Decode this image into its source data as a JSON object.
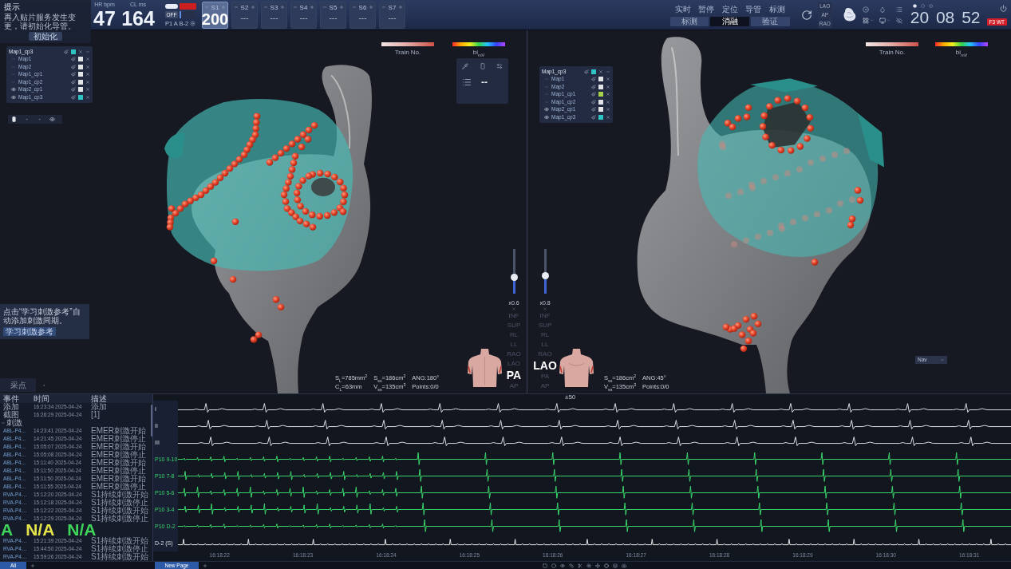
{
  "header": {
    "notice": {
      "title": "提示",
      "message": "再入贴片服务发生变更，请初始化导管。",
      "button": "初始化"
    },
    "vitals": [
      {
        "label": "HR bpm",
        "value": "47"
      },
      {
        "label": "CL ms",
        "value": "164"
      }
    ],
    "stimulator": {
      "switch_on": true,
      "output": "OFF",
      "channel": "P1 A B-2"
    },
    "stim_steps": [
      {
        "label": "S1",
        "value": "200",
        "selected": true
      },
      {
        "label": "S2",
        "value": "---",
        "selected": false
      },
      {
        "label": "S3",
        "value": "---",
        "selected": false
      },
      {
        "label": "S4",
        "value": "---",
        "selected": false
      },
      {
        "label": "S5",
        "value": "---",
        "selected": false
      },
      {
        "label": "S6",
        "value": "---",
        "selected": false
      },
      {
        "label": "S7",
        "value": "---",
        "selected": false
      }
    ],
    "mode_buttons": [
      "实时",
      "暂停",
      "定位",
      "导管",
      "标测"
    ],
    "workflow_tabs": [
      {
        "label": "标测",
        "selected": false
      },
      {
        "label": "消融",
        "selected": true
      },
      {
        "label": "验证",
        "selected": false
      }
    ],
    "view_presets": [
      "LAO",
      "AP",
      "RAO"
    ],
    "clock": "20 08 52",
    "alert_badge": "F3 WT"
  },
  "views": [
    {
      "map_list": {
        "title": "Map1_cp3",
        "color": "#2ec4c4",
        "items": [
          {
            "name": "Map1",
            "visible": false,
            "color": "#e2e4e8"
          },
          {
            "name": "Map2",
            "visible": false,
            "color": "#e2e4e8"
          },
          {
            "name": "Map1_cp1",
            "visible": false,
            "color": "#e2e4e8"
          },
          {
            "name": "Map1_cp2",
            "visible": false,
            "color": "#e2e4e8"
          },
          {
            "name": "Map2_cp1",
            "visible": true,
            "color": "#e2e4e8"
          },
          {
            "name": "Map1_cp3",
            "visible": true,
            "color": "#2ec4c4"
          }
        ]
      },
      "legends": [
        {
          "kind": "train",
          "label": "Train No."
        },
        {
          "kind": "voltage",
          "label": "bi$_{mV}$"
        }
      ],
      "value_panel": {
        "value": "--"
      },
      "zoom": {
        "label": "x0.6",
        "level": 0.35
      },
      "orientations": [
        {
          "label": "INF",
          "selected": false
        },
        {
          "label": "SUP",
          "selected": false
        },
        {
          "label": "RL",
          "selected": false
        },
        {
          "label": "LL",
          "selected": false
        },
        {
          "label": "RAO",
          "selected": false
        },
        {
          "label": "LAO",
          "selected": false
        },
        {
          "label": "PA",
          "selected": true
        },
        {
          "label": "AP",
          "selected": false
        }
      ],
      "stats": [
        "S$_{L}$=785mm$^{2}$",
        "S$_{ss}$=186cm$^{2}$",
        "ANG:180°",
        "C$_{L}$=63mm",
        "V$_{ss}$=135cm$^{3}$",
        "Points:0/0"
      ]
    },
    {
      "map_list": {
        "title": "Map1_cp3",
        "color": "#2ec4c4",
        "items": [
          {
            "name": "Map1",
            "visible": false,
            "color": "#e2e4e8"
          },
          {
            "name": "Map2",
            "visible": false,
            "color": "#e2e4e8"
          },
          {
            "name": "Map1_cp1",
            "visible": false,
            "color": "#a8d24a"
          },
          {
            "name": "Map1_cp2",
            "visible": false,
            "color": "#e2e4e8"
          },
          {
            "name": "Map2_cp1",
            "visible": true,
            "color": "#e2e4e8"
          },
          {
            "name": "Map1_cp3",
            "visible": true,
            "color": "#2ec4c4"
          }
        ]
      },
      "legends": [
        {
          "kind": "train",
          "label": "Train No."
        },
        {
          "kind": "voltage",
          "label": "bi$_{mV}$"
        }
      ],
      "zoom": {
        "label": "x0.8",
        "level": 0.38
      },
      "orientations": [
        {
          "label": "INF",
          "selected": false
        },
        {
          "label": "SUP",
          "selected": false
        },
        {
          "label": "RL",
          "selected": false
        },
        {
          "label": "LL",
          "selected": false
        },
        {
          "label": "RAO",
          "selected": false
        },
        {
          "label": "LAO",
          "selected": true
        },
        {
          "label": "PA",
          "selected": false
        },
        {
          "label": "AP",
          "selected": false
        }
      ],
      "stats": [
        "S$_{ss}$=186cm$^{2}$",
        "ANG:45°",
        "V$_{ss}$=135cm$^{3}$",
        "Points:0/0"
      ],
      "nav_menu": "Nav"
    }
  ],
  "hint": {
    "message": "点击“学习刺激参考”自动添加刺激间期。",
    "button": "学习刺激参考"
  },
  "capture_tab": "采点",
  "events": {
    "columns": [
      "事件",
      "时间",
      "描述"
    ],
    "rows": [
      {
        "event": "添加",
        "time": "16:23:34 2025-04-24",
        "description": "添加"
      },
      {
        "event": "截图",
        "time": "16:26:29 2025-04-24",
        "description": "[1]"
      },
      {
        "event": "刺激",
        "expanded": true,
        "children": [
          {
            "event": "ABL-P4…",
            "time": "14:23:41 2025-04-24",
            "description": "EMER刺激开始"
          },
          {
            "event": "ABL-P4…",
            "time": "14:21:45 2025-04-24",
            "description": "EMER刺激停止"
          },
          {
            "event": "ABL-P4…",
            "time": "15:05:07 2025-04-24",
            "description": "EMER刺激开始"
          },
          {
            "event": "ABL-P4…",
            "time": "15:05:08 2025-04-24",
            "description": "EMER刺激停止"
          },
          {
            "event": "ABL-P4…",
            "time": "15:11:40 2025-04-24",
            "description": "EMER刺激开始"
          },
          {
            "event": "ABL-P4…",
            "time": "15:11:50 2025-04-24",
            "description": "EMER刺激停止"
          },
          {
            "event": "ABL-P4…",
            "time": "15:11:50 2025-04-24",
            "description": "EMER刺激开始"
          },
          {
            "event": "ABL-P4…",
            "time": "15:11:55 2025-04-24",
            "description": "EMER刺激停止"
          },
          {
            "event": "RVA-P4…",
            "time": "15:12:20 2025-04-24",
            "description": "S1持续刺激开始"
          },
          {
            "event": "RVA-P4…",
            "time": "15:12:18 2025-04-24",
            "description": "S1持续刺激停止"
          },
          {
            "event": "RVA-P4…",
            "time": "15:12:22 2025-04-24",
            "description": "S1持续刺激开始"
          },
          {
            "event": "RVA-P4…",
            "time": "15:12:29 2025-04-24",
            "description": "S1持续刺激停止"
          },
          {
            "event": "RVA-P4…",
            "time": "15:21:39 2025-04-24",
            "description": "S1持续刺激开始"
          },
          {
            "event": "RVA-P4…",
            "time": "15:44:50 2025-04-24",
            "description": "S1持续刺激停止"
          },
          {
            "event": "RVA-P4…",
            "time": "15:59:26 2025-04-24",
            "description": "S1持续刺激开始"
          }
        ]
      }
    ]
  },
  "readouts": [
    {
      "text": "A",
      "color": "#3fd45a"
    },
    {
      "text": "N/A",
      "color": "#e4e44a"
    },
    {
      "text": "N/A",
      "color": "#3fd45a"
    }
  ],
  "ecg": {
    "scale": "±50",
    "channels": [
      {
        "label": "I",
        "kind": "surface"
      },
      {
        "label": "II",
        "kind": "surface"
      },
      {
        "label": "III",
        "kind": "surface"
      },
      {
        "label": "P10 9-10",
        "kind": "intracardiac"
      },
      {
        "label": "P10 7-8",
        "kind": "intracardiac"
      },
      {
        "label": "P10 5-6",
        "kind": "intracardiac"
      },
      {
        "label": "P10 3-4",
        "kind": "intracardiac"
      },
      {
        "label": "P10 D-2",
        "kind": "intracardiac"
      },
      {
        "label": "D-2 (S)",
        "kind": "stim"
      }
    ],
    "times": [
      "16:18:22",
      "16:18:23",
      "16:18:24",
      "16:18:25",
      "16:18:26",
      "16:18:27",
      "16:18:28",
      "16:18:29",
      "16:18:30",
      "16:18:31"
    ]
  },
  "status_bar": {
    "filter_tabs": [
      {
        "label": "All",
        "selected": true
      }
    ],
    "page_tabs": [
      {
        "label": "New Page",
        "selected": true
      }
    ]
  }
}
